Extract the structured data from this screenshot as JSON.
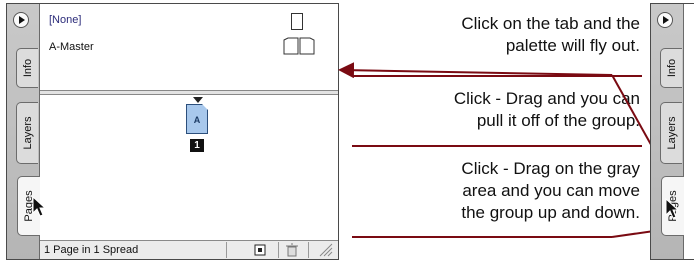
{
  "palette": {
    "tabs": [
      "Info",
      "Layers",
      "Pages"
    ],
    "masters": [
      "[None]",
      "A-Master"
    ],
    "page_thumbnail": {
      "prefix": "A",
      "number": "1"
    },
    "status_text": "1 Page in 1 Spread"
  },
  "callouts": [
    "Click on the tab and the palette will fly out.",
    "Click - Drag and you can pull it off of the group.",
    "Click - Drag on the gray area and you can move the group up and down."
  ],
  "callout_lines": {
    "c1": [
      "Click on the tab and the",
      "palette will fly out."
    ],
    "c2": [
      "Click - Drag and you can",
      "pull it off of the group."
    ],
    "c3": [
      "Click - Drag on the gray",
      "area and you can move",
      "the group up and down."
    ]
  },
  "right_palette": {
    "tabs": [
      "Info",
      "Layers",
      "Pages"
    ]
  },
  "colors": {
    "accent_line": "#7a0a12",
    "page_thumb": "#a8c8ec",
    "palette_gray": "#8f8f8f"
  },
  "icons": [
    "collapse-arrow-icon",
    "single-page-icon",
    "spread-page-icon",
    "new-page-icon",
    "trash-icon",
    "resize-grip-icon",
    "mouse-cursor-icon"
  ]
}
